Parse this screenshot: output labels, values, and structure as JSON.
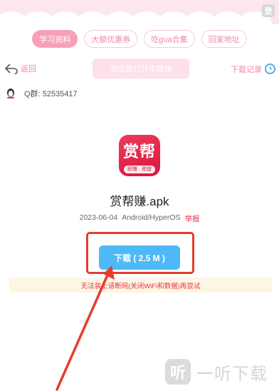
{
  "header": {
    "corner_badge": "登"
  },
  "tabs": [
    {
      "label": "学习资料",
      "active": true
    },
    {
      "label": "大额优惠券",
      "active": false
    },
    {
      "label": "吃gua合集",
      "active": false
    },
    {
      "label": "回家地址",
      "active": false
    }
  ],
  "nav": {
    "back_label": "返回",
    "open_in_browser": "浏览器打开本链接",
    "download_records": "下载记录"
  },
  "qq": {
    "label": "Q群:",
    "number": "52535417"
  },
  "app": {
    "icon_title": "赏帮",
    "icon_subtitle": "即赚 · 即提",
    "name": "赏帮赚.apk",
    "date": "2023-06-04",
    "platform": "Android/HyperOS",
    "report": "举报"
  },
  "download": {
    "label": "下载 ( 2.5 M )"
  },
  "warning": "无法装上请断网(关闭WiFi和数据)再尝试",
  "watermark": {
    "text": "一听下载"
  },
  "colors": {
    "accent_pink": "#f08aa4",
    "download_blue": "#4fb9f7",
    "annotation_red": "#e53e2c",
    "report_red": "#e8344a"
  }
}
